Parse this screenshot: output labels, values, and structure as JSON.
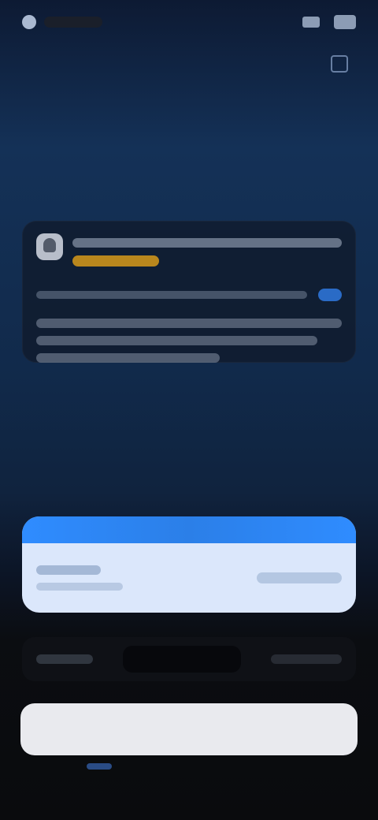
{
  "status": {},
  "header": {
    "title": ""
  },
  "notice_card": {
    "alert_highlight_color": "#d79a1a",
    "accent_color": "#2d73d6",
    "bell_icon": "bell-icon"
  },
  "bottom_panel": {
    "accent_color": "#2f8cff",
    "background": "#dbe7fb"
  },
  "cta": {
    "label": ""
  }
}
